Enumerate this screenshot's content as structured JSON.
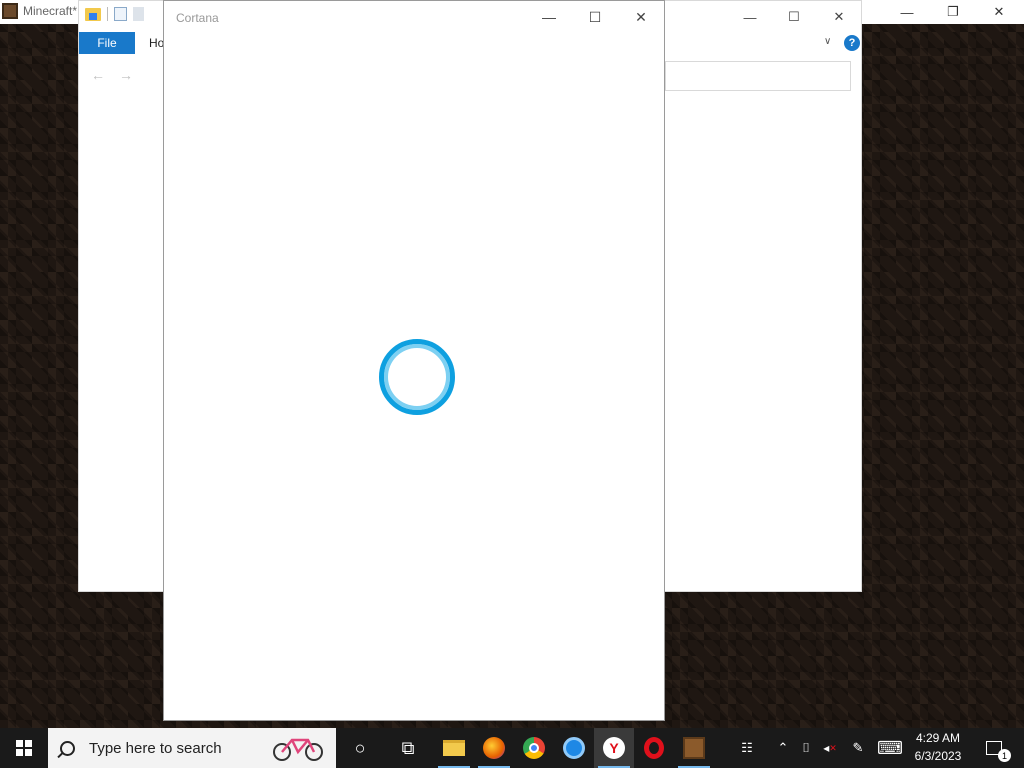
{
  "minecraft": {
    "title": "Minecraft*",
    "minimize_icon": "—",
    "restore_icon": "❐",
    "close_icon": "✕"
  },
  "explorer": {
    "file_tab": "File",
    "home_tab": "Ho",
    "help_icon": "?",
    "chevron": "∨",
    "back_icon": "←",
    "forward_icon": "→",
    "minimize_icon": "—",
    "maximize_icon": "☐",
    "close_icon": "✕"
  },
  "cortana": {
    "title": "Cortana",
    "minimize_icon": "—",
    "maximize_icon": "☐",
    "close_icon": "✕",
    "accent_color": "#0ea0e0"
  },
  "taskbar": {
    "search_placeholder": "Type here to search",
    "cortana_glyph": "○",
    "task_view_glyph": "⧉",
    "pinned": [
      {
        "name": "file-explorer",
        "color": "#f2c94c"
      },
      {
        "name": "firefox",
        "color": "#e66000"
      },
      {
        "name": "chrome",
        "color": "#34a853"
      },
      {
        "name": "brave-shield",
        "color": "#1e88e5"
      },
      {
        "name": "yandex-browser",
        "color": "#ffffff"
      },
      {
        "name": "opera",
        "color": "#e0101b"
      },
      {
        "name": "minecraft-launcher",
        "color": "#8b5a2b"
      }
    ],
    "tray": {
      "people_glyph": "☷",
      "chevron_glyph": "⌃",
      "network_glyph": "⌷",
      "volume_glyph": "✕",
      "pen_glyph": "✎",
      "keyboard_glyph": "⌨",
      "time": "4:29 AM",
      "date": "6/3/2023",
      "notification_count": "1"
    }
  }
}
